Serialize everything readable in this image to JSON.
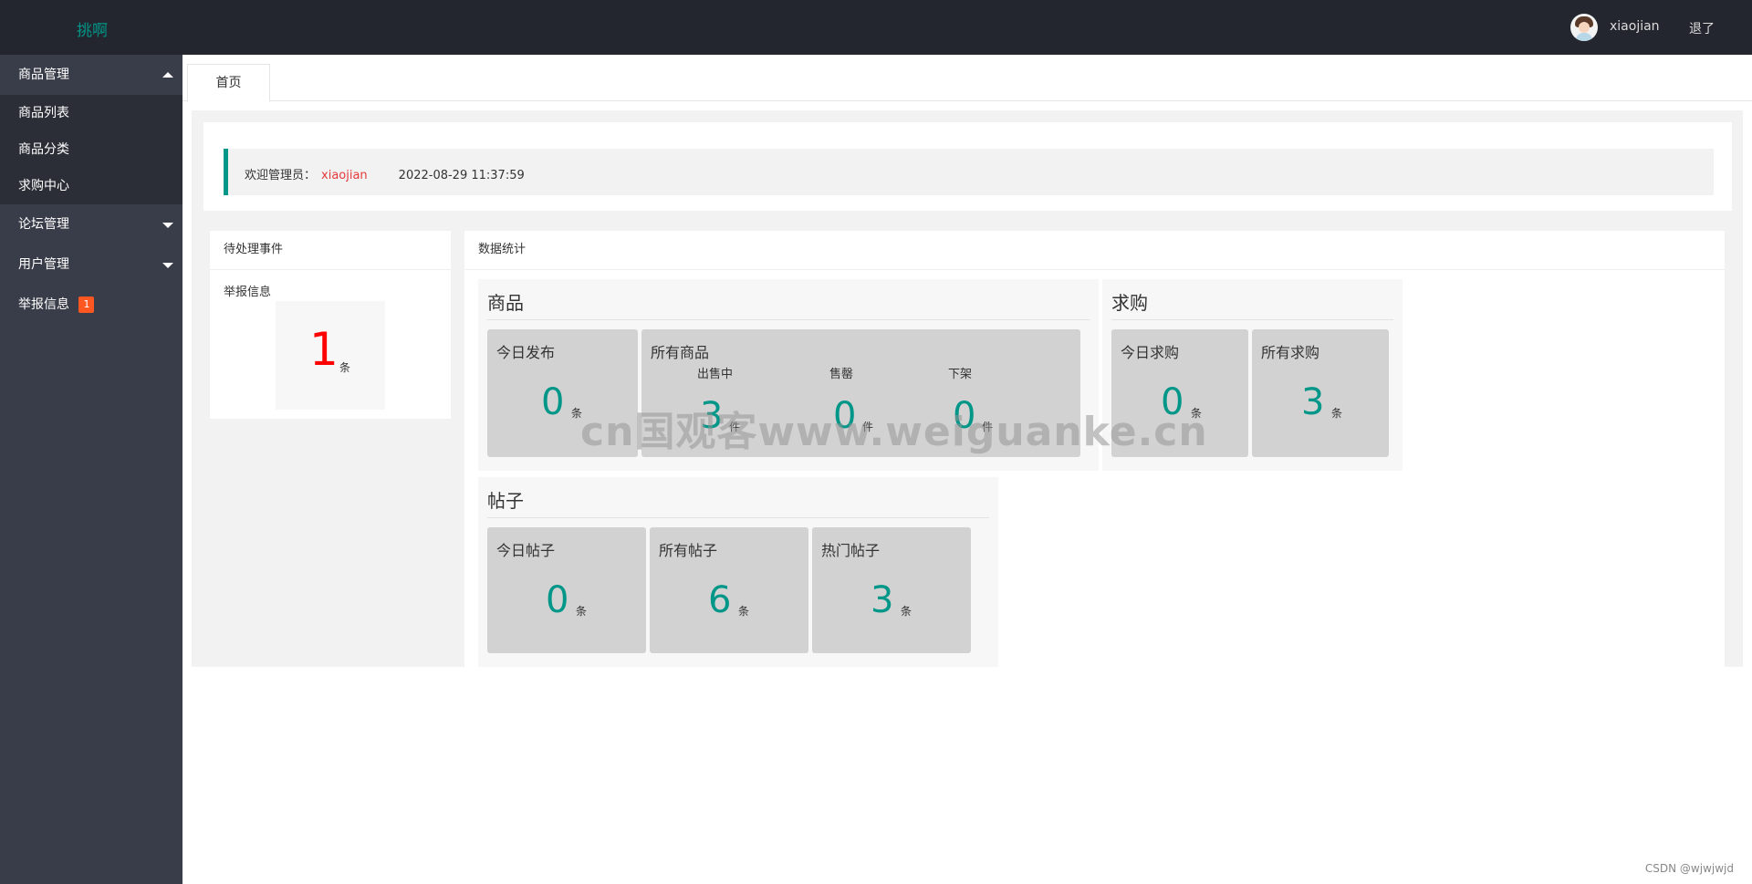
{
  "header": {
    "logo": "挑啊",
    "username": "xiaojian",
    "logout": "退了"
  },
  "sidebar": {
    "groups": [
      {
        "label": "商品管理",
        "expanded": true,
        "items": [
          "商品列表",
          "商品分类",
          "求购中心"
        ]
      },
      {
        "label": "论坛管理",
        "expanded": false
      },
      {
        "label": "用户管理",
        "expanded": false
      },
      {
        "label": "举报信息",
        "badge": "1"
      }
    ]
  },
  "tabs": [
    {
      "label": "首页",
      "active": true
    }
  ],
  "welcome": {
    "prefix": "欢迎管理员：",
    "name": "xiaojian",
    "time": "2022-08-29 11:37:59"
  },
  "pending": {
    "title": "待处理事件",
    "label": "举报信息",
    "count": "1",
    "unit": "条"
  },
  "stats": {
    "title": "数据统计",
    "goods": {
      "title": "商品",
      "today_label": "今日发布",
      "today_value": "0",
      "today_unit": "条",
      "all_label": "所有商品",
      "on_sale_label": "出售中",
      "on_sale_value": "3",
      "on_sale_unit": "件",
      "sold_out_label": "售罄",
      "sold_out_value": "0",
      "sold_out_unit": "件",
      "off_shelf_label": "下架",
      "off_shelf_value": "0",
      "off_shelf_unit": "件"
    },
    "want": {
      "title": "求购",
      "today_label": "今日求购",
      "today_value": "0",
      "today_unit": "条",
      "all_label": "所有求购",
      "all_value": "3",
      "all_unit": "条"
    },
    "posts": {
      "title": "帖子",
      "today_label": "今日帖子",
      "today_value": "0",
      "today_unit": "条",
      "all_label": "所有帖子",
      "all_value": "6",
      "all_unit": "条",
      "hot_label": "热门帖子",
      "hot_value": "3",
      "hot_unit": "条"
    }
  },
  "watermark": "cn国观客www.weiguanke.cn",
  "credit": "CSDN @wjwjwjd",
  "colors": {
    "accent": "#009688",
    "topbar": "#23262e",
    "sidebar": "#393d49",
    "badge": "#ff5722",
    "alert": "#ff0000"
  }
}
